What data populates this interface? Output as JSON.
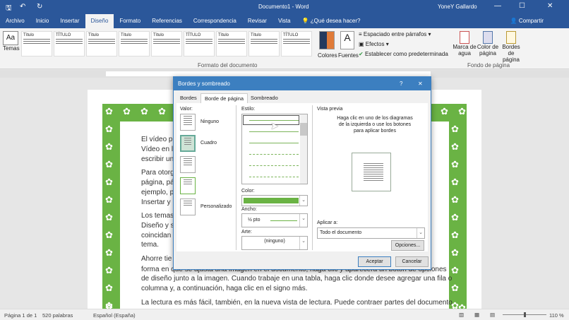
{
  "window": {
    "title": "Documento1 - Word",
    "user": "YoneY Gallardo"
  },
  "tabs": [
    "Archivo",
    "Inicio",
    "Insertar",
    "Diseño",
    "Formato",
    "Referencias",
    "Correspondencia",
    "Revisar",
    "Vista"
  ],
  "tell_me": "¿Qué desea hacer?",
  "share": "Compartir",
  "ribbon": {
    "temas": "Temas",
    "gallery_titles": [
      "Título",
      "TÍTULO",
      "Título",
      "Título",
      "Título",
      "TÍTULO",
      "Título",
      "Título",
      "TÍTULO"
    ],
    "colores": "Colores",
    "fuentes": "Fuentes",
    "espaciado": "Espaciado entre párrafos",
    "efectos": "Efectos",
    "establecer": "Establecer como predeterminada",
    "group_formato": "Formato del documento",
    "marca": "Marca de agua",
    "color_pagina": "Color de página",
    "bordes_pagina": "Bordes de página",
    "group_fondo": "Fondo de página"
  },
  "document": {
    "lines": [
      "El vídeo pr",
      "Vídeo en l",
      "escribir un",
      "Para otorg",
      "página, pá",
      "ejemplo, p",
      "Insertar y",
      "Los temas",
      "Diseño y s",
      "coincidan",
      "tema.",
      "Ahorre tie",
      "forma en que se ajusta una imagen en el documento, haga clic y aparecerá un botón de opciones",
      "de diseño junto a la imagen. Cuando trabaje en una tabla, haga clic donde desee agregar una fila o",
      "columna y, a continuación, haga clic en el signo más.",
      "La lectura es más fácil, también, en la nueva vista de lectura. Puede contraer partes del documento"
    ]
  },
  "dialog": {
    "title": "Bordes y sombreado",
    "help": "?",
    "close": "✕",
    "tabs": [
      "Bordes",
      "Borde de página",
      "Sombreado"
    ],
    "valor": "Valor:",
    "settings": [
      "Ninguno",
      "Cuadro",
      "Personalizado"
    ],
    "estilo": "Estilo:",
    "color_label": "Color:",
    "color_value": "#6ab344",
    "ancho_label": "Ancho:",
    "ancho_value": "½ pto",
    "arte_label": "Arte:",
    "arte_value": "(ninguno)",
    "vista_previa": "Vista previa",
    "preview_hint": "Haga clic en uno de los diagramas de la izquierda o use los botones para aplicar bordes",
    "aplicar_label": "Aplicar a:",
    "aplicar_value": "Todo el documento",
    "opciones": "Opciones...",
    "aceptar": "Aceptar",
    "cancelar": "Cancelar"
  },
  "status": {
    "page": "Página 1 de 1",
    "words": "520 palabras",
    "lang": "Español (España)",
    "zoom": "110 %"
  }
}
